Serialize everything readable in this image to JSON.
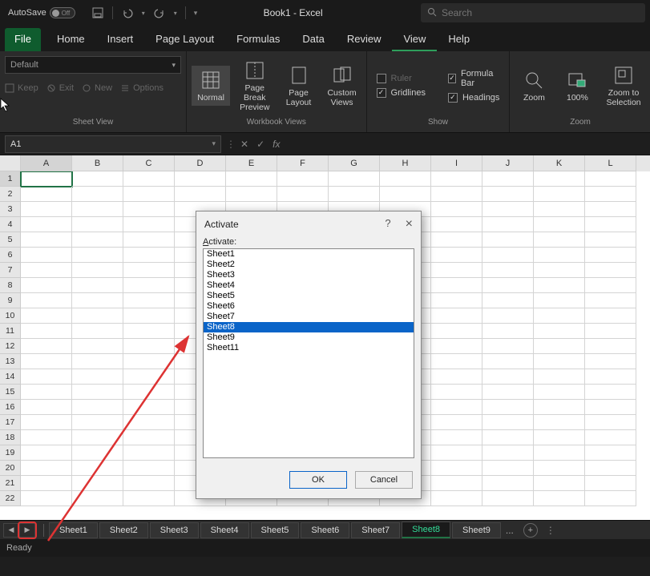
{
  "titlebar": {
    "autosave": "AutoSave",
    "toggle_state": "Off",
    "doc_title": "Book1 - Excel",
    "search_placeholder": "Search"
  },
  "menu": {
    "file": "File",
    "tabs": [
      "Home",
      "Insert",
      "Page Layout",
      "Formulas",
      "Data",
      "Review",
      "View",
      "Help"
    ],
    "active_index": 6
  },
  "ribbon": {
    "sheet_view": {
      "select_value": "Default",
      "keep": "Keep",
      "exit": "Exit",
      "new": "New",
      "options": "Options",
      "group_label": "Sheet View"
    },
    "workbook_views": {
      "normal": "Normal",
      "page_break": "Page Break\nPreview",
      "page_layout": "Page\nLayout",
      "custom_views": "Custom\nViews",
      "group_label": "Workbook Views"
    },
    "show": {
      "ruler": "Ruler",
      "gridlines": "Gridlines",
      "formula_bar": "Formula Bar",
      "headings": "Headings",
      "group_label": "Show",
      "ruler_checked": false,
      "gridlines_checked": true,
      "formula_bar_checked": true,
      "headings_checked": true
    },
    "zoom": {
      "zoom": "Zoom",
      "hundred": "100%",
      "to_selection": "Zoom to\nSelection",
      "group_label": "Zoom"
    }
  },
  "namebox": {
    "value": "A1"
  },
  "grid": {
    "columns": [
      "A",
      "B",
      "C",
      "D",
      "E",
      "F",
      "G",
      "H",
      "I",
      "J",
      "K",
      "L"
    ],
    "rows": [
      1,
      2,
      3,
      4,
      5,
      6,
      7,
      8,
      9,
      10,
      11,
      12,
      13,
      14,
      15,
      16,
      17,
      18,
      19,
      20,
      21,
      22
    ],
    "active_col": 0,
    "active_row": 0
  },
  "sheets": {
    "visible": [
      "Sheet1",
      "Sheet2",
      "Sheet3",
      "Sheet4",
      "Sheet5",
      "Sheet6",
      "Sheet7",
      "Sheet8",
      "Sheet9"
    ],
    "active": "Sheet8",
    "more_indicator": "..."
  },
  "statusbar": {
    "text": "Ready"
  },
  "dialog": {
    "title": "Activate",
    "label": "Activate:",
    "help": "?",
    "close": "×",
    "items": [
      "Sheet1",
      "Sheet2",
      "Sheet3",
      "Sheet4",
      "Sheet5",
      "Sheet6",
      "Sheet7",
      "Sheet8",
      "Sheet9",
      "Sheet11"
    ],
    "selected": "Sheet8",
    "ok": "OK",
    "cancel": "Cancel"
  }
}
